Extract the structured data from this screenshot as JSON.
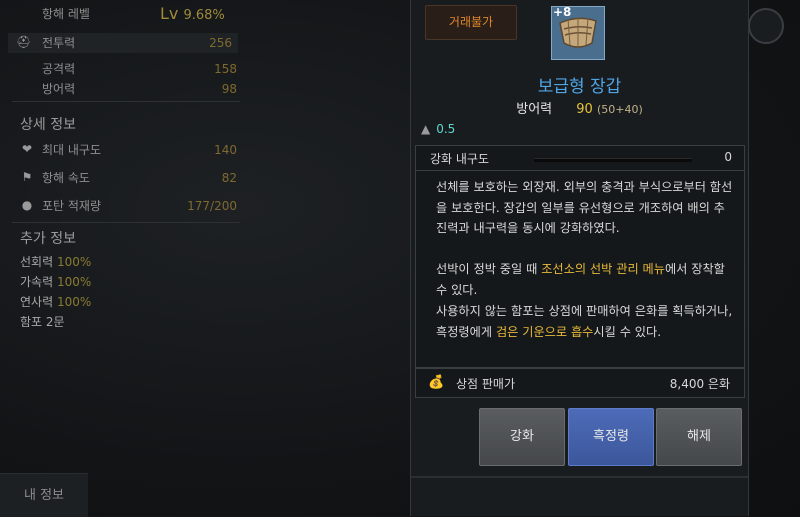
{
  "left": {
    "level_label": "항해 레벨",
    "level_prefix": "Lv",
    "level_value": "9.68%",
    "stats": [
      {
        "label": "전투력",
        "value": "256"
      },
      {
        "label": "공격력",
        "value": "158"
      },
      {
        "label": "방어력",
        "value": "98"
      }
    ],
    "detail_title": "상세 정보",
    "details": [
      {
        "label": "최대 내구도",
        "value": "140",
        "icon": "shield-heart-icon"
      },
      {
        "label": "항해 속도",
        "value": "82",
        "icon": "flag-icon"
      },
      {
        "label": "포탄 적재량",
        "value": "177/200",
        "icon": "cannonball-icon"
      }
    ],
    "extra_title": "추가 정보",
    "extras": [
      {
        "label": "선회력",
        "value": "100%"
      },
      {
        "label": "가속력",
        "value": "100%"
      },
      {
        "label": "연사력",
        "value": "100%"
      },
      {
        "label": "함포 2문",
        "value": ""
      }
    ],
    "my_info_button": "내 정보"
  },
  "tooltip": {
    "trade_badge": "거래불가",
    "enhance_level": "+8",
    "item_name": "보급형 장갑",
    "defense_label": "방어력",
    "defense_value": "90",
    "defense_detail": "(50+40)",
    "weight": "0.5",
    "durability_label": "강화 내구도",
    "durability_value": "0",
    "durability_fraction": 0,
    "desc1": "선체를 보호하는 외장재. 외부의 충격과 부식으로부터 함선을 보호한다. 장갑의 일부를 유선형으로 개조하여 배의 추진력과 내구력을 동시에 강화하였다.",
    "desc2_a": "선박이 정박 중일 때 ",
    "desc2_gold": "조선소의 선박 관리 메뉴",
    "desc2_b": "에서 장착할 수 있다.",
    "desc3_a": "사용하지 않는 함포는 상점에 판매하여 은화를 획득하거나, 흑정령에게 ",
    "desc3_gold": "검은 기운으로 흡수",
    "desc3_b": "시킬 수 있다.",
    "price_label": "상점 판매가",
    "price_value": "8,400 은화",
    "buttons": [
      "강화",
      "흑정령",
      "해제"
    ]
  },
  "colors": {
    "item_name": "#4fa6e6",
    "gold_text": "#e8b83a",
    "trade_badge": "#e0862a",
    "primary_button": "#4d6bb8"
  }
}
